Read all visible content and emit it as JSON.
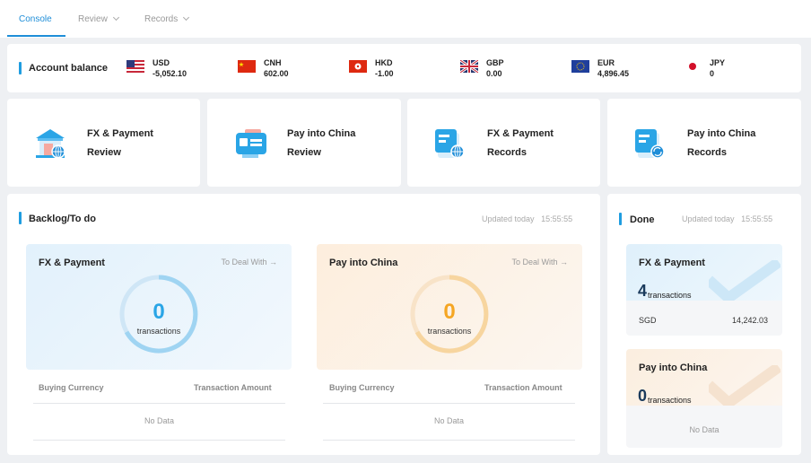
{
  "nav": {
    "tabs": [
      {
        "label": "Console",
        "active": true
      },
      {
        "label": "Review",
        "active": false
      },
      {
        "label": "Records",
        "active": false
      }
    ]
  },
  "balance": {
    "title": "Account balance",
    "currencies": [
      {
        "code": "USD",
        "value": "-5,052.10",
        "flag": "us-flag"
      },
      {
        "code": "CNH",
        "value": "602.00",
        "flag": "cn-flag"
      },
      {
        "code": "HKD",
        "value": "-1.00",
        "flag": "hk-flag"
      },
      {
        "code": "GBP",
        "value": "0.00",
        "flag": "uk-flag"
      },
      {
        "code": "EUR",
        "value": "4,896.45",
        "flag": "eu-flag"
      },
      {
        "code": "JPY",
        "value": "0",
        "flag": "jp-flag"
      }
    ]
  },
  "shortcuts": [
    {
      "line1": "FX & Payment",
      "line2": "Review",
      "icon": "bank-review-icon"
    },
    {
      "line1": "Pay into China",
      "line2": "Review",
      "icon": "id-card-review-icon"
    },
    {
      "line1": "FX & Payment",
      "line2": "Records",
      "icon": "globe-records-icon"
    },
    {
      "line1": "Pay into China",
      "line2": "Records",
      "icon": "refresh-records-icon"
    }
  ],
  "backlog": {
    "title": "Backlog/To do",
    "updated_label": "Updated today",
    "updated_time": "15:55:55",
    "panels": [
      {
        "title": "FX & Payment",
        "deal": "To Deal With →",
        "count": "0",
        "unit": "transactions",
        "col1": "Buying Currency",
        "col2": "Transaction Amount",
        "empty": "No Data"
      },
      {
        "title": "Pay into China",
        "deal": "To Deal With →",
        "count": "0",
        "unit": "transactions",
        "col1": "Buying Currency",
        "col2": "Transaction Amount",
        "empty": "No Data"
      }
    ]
  },
  "done": {
    "title": "Done",
    "updated_label": "Updated today",
    "updated_time": "15:55:55",
    "fx": {
      "title": "FX & Payment",
      "count": "4",
      "unit": "transactions",
      "currency": "SGD",
      "amount": "14,242.03"
    },
    "china": {
      "title": "Pay into China",
      "count": "0",
      "unit": "transactions",
      "empty": "No Data"
    }
  },
  "colors": {
    "accent": "#1f8ed8",
    "blue_ring": "#2aa5e6",
    "orange_ring": "#f5a623"
  }
}
